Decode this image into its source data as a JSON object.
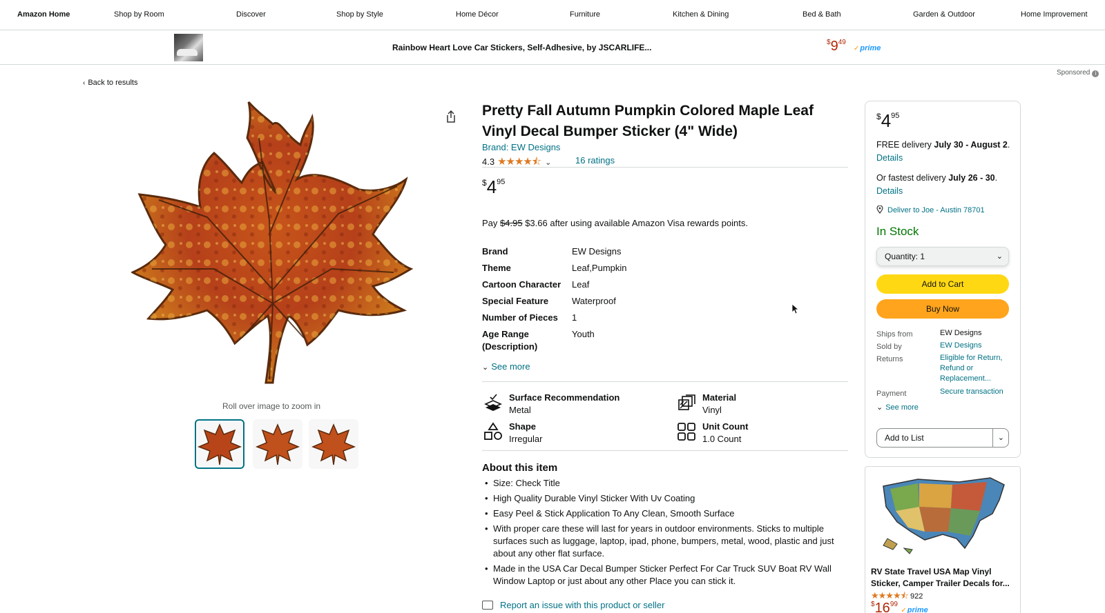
{
  "nav": {
    "items": [
      "Amazon Home",
      "Shop by Room",
      "Discover",
      "Shop by Style",
      "Home Décor",
      "Furniture",
      "Kitchen & Dining",
      "Bed & Bath",
      "Garden & Outdoor",
      "Home Improvement"
    ]
  },
  "banner": {
    "title": "Rainbow Heart Love Car Stickers, Self-Adhesive, by JSCARLIFE...",
    "price_symbol": "$",
    "price_whole": "9",
    "price_fraction": "49",
    "prime": "prime"
  },
  "sponsored_label": "Sponsored",
  "back_link": "Back to results",
  "gallery": {
    "zoom_hint": "Roll over image to zoom in",
    "selected_thumb_index": 0
  },
  "product": {
    "title": "Pretty Fall Autumn Pumpkin Colored Maple Leaf Vinyl Decal Bumper Sticker (4\" Wide)",
    "brand_link": "Brand: EW Designs",
    "rating": "4.3",
    "stars": "★★★★⯪",
    "ratings_count": "16 ratings",
    "price_symbol": "$",
    "price_whole": "4",
    "price_fraction": "95",
    "pay_prefix": "Pay",
    "pay_struck": "$4.95",
    "pay_suffix": "$3.66 after using available Amazon Visa rewards points.",
    "specs": [
      {
        "key": "Brand",
        "value": "EW Designs"
      },
      {
        "key": "Theme",
        "value": "Leaf,Pumpkin"
      },
      {
        "key": "Cartoon Character",
        "value": "Leaf"
      },
      {
        "key": "Special Feature",
        "value": "Waterproof"
      },
      {
        "key": "Number of Pieces",
        "value": "1"
      },
      {
        "key": "Age Range (Description)",
        "value": "Youth"
      }
    ],
    "see_more": "See more",
    "features": [
      {
        "label": "Surface Recommendation",
        "value": "Metal",
        "icon": "surface-icon"
      },
      {
        "label": "Material",
        "value": "Vinyl",
        "icon": "material-icon"
      },
      {
        "label": "Shape",
        "value": "Irregular",
        "icon": "shape-icon"
      },
      {
        "label": "Unit Count",
        "value": "1.0 Count",
        "icon": "unit-count-icon"
      }
    ],
    "about_heading": "About this item",
    "bullets": [
      "Size: Check Title",
      "High Quality Durable Vinyl Sticker With Uv Coating",
      "Easy Peel & Stick Application To Any Clean, Smooth Surface",
      "With proper care these will last for years in outdoor environments. Sticks to multiple surfaces such as luggage, laptop, ipad, phone, bumpers, metal, wood, plastic and just about any other flat surface.",
      "Made in the USA Car Decal Bumper Sticker Perfect For Car Truck SUV Boat RV Wall Window Laptop or just about any other Place you can stick it."
    ],
    "report": "Report an issue with this product or seller"
  },
  "buybox": {
    "price_symbol": "$",
    "price_whole": "4",
    "price_fraction": "95",
    "free_delivery_prefix": "FREE delivery",
    "free_delivery_dates": "July 30 - August 2",
    "details": "Details",
    "fastest_prefix": "Or fastest delivery",
    "fastest_dates": "July 26 - 30",
    "deliver_to": "Deliver to Joe - Austin 78701",
    "stock": "In Stock",
    "quantity_label": "Quantity:",
    "quantity_value": "1",
    "add_to_cart": "Add to Cart",
    "buy_now": "Buy Now",
    "ships_from_label": "Ships from",
    "ships_from": "EW Designs",
    "sold_by_label": "Sold by",
    "sold_by": "EW Designs",
    "returns_label": "Returns",
    "returns": "Eligible for Return, Refund or Replacement...",
    "payment_label": "Payment",
    "payment": "Secure transaction",
    "see_more": "See more",
    "add_to_list": "Add to List"
  },
  "ad": {
    "title": "RV State Travel USA Map Vinyl Sticker, Camper Trailer Decals for...",
    "stars": "★★★★⯪",
    "rating_count": "922",
    "price_symbol": "$",
    "price_whole": "16",
    "price_fraction": "99",
    "prime": "prime"
  },
  "colors": {
    "link": "#007185",
    "price_red": "#b12704",
    "in_stock": "#007600",
    "cart_button": "#ffd814",
    "buy_button": "#ffa41c",
    "star": "#de7921"
  }
}
